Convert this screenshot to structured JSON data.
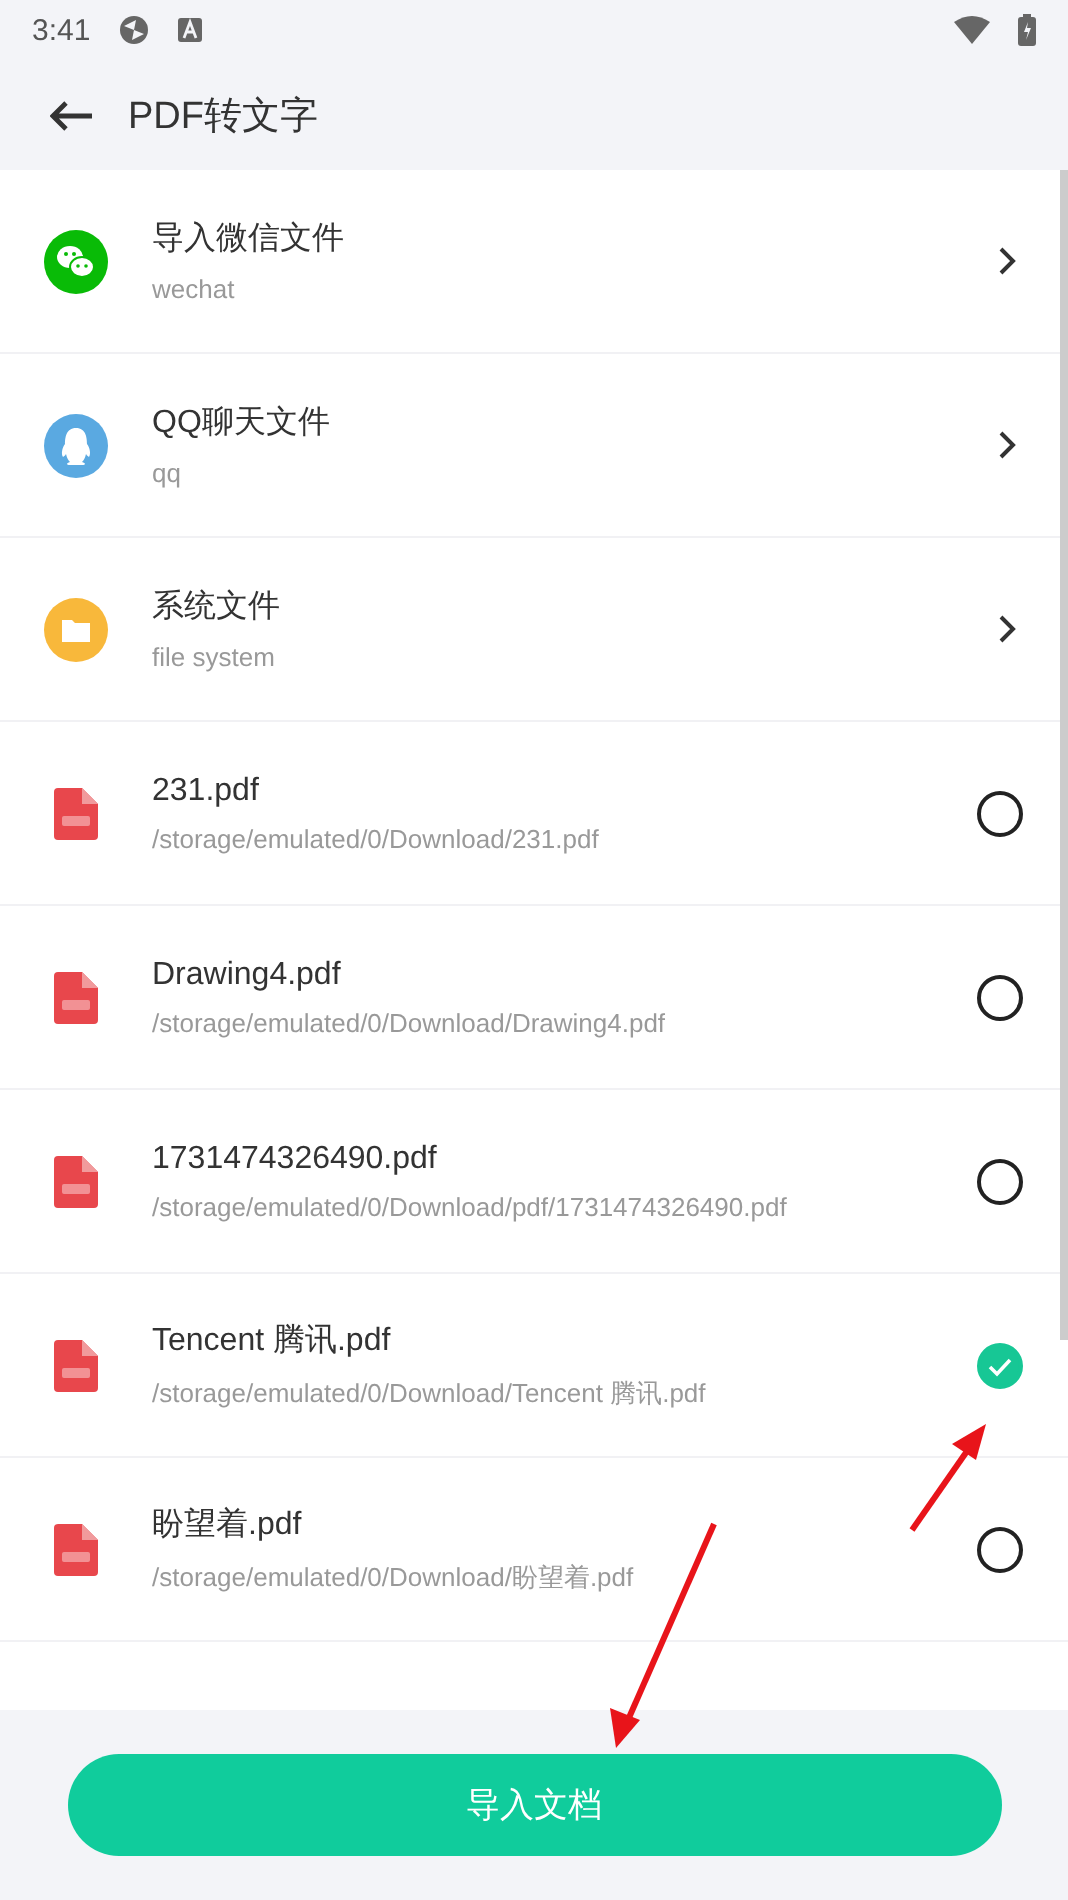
{
  "status_bar": {
    "time": "3:41"
  },
  "header": {
    "title": "PDF转文字"
  },
  "sources": [
    {
      "kind": "wechat",
      "title": "导入微信文件",
      "subtitle": "wechat"
    },
    {
      "kind": "qq",
      "title": "QQ聊天文件",
      "subtitle": "qq"
    },
    {
      "kind": "folder",
      "title": "系统文件",
      "subtitle": "file system"
    }
  ],
  "files": [
    {
      "name": "231.pdf",
      "path": "/storage/emulated/0/Download/231.pdf",
      "selected": false
    },
    {
      "name": "Drawing4.pdf",
      "path": "/storage/emulated/0/Download/Drawing4.pdf",
      "selected": false
    },
    {
      "name": "1731474326490.pdf",
      "path": "/storage/emulated/0/Download/pdf/1731474326490.pdf",
      "selected": false
    },
    {
      "name": "Tencent 腾讯.pdf",
      "path": "/storage/emulated/0/Download/Tencent 腾讯.pdf",
      "selected": true
    },
    {
      "name": "盼望着.pdf",
      "path": "/storage/emulated/0/Download/盼望着.pdf",
      "selected": false
    }
  ],
  "import_button": "导入文档"
}
